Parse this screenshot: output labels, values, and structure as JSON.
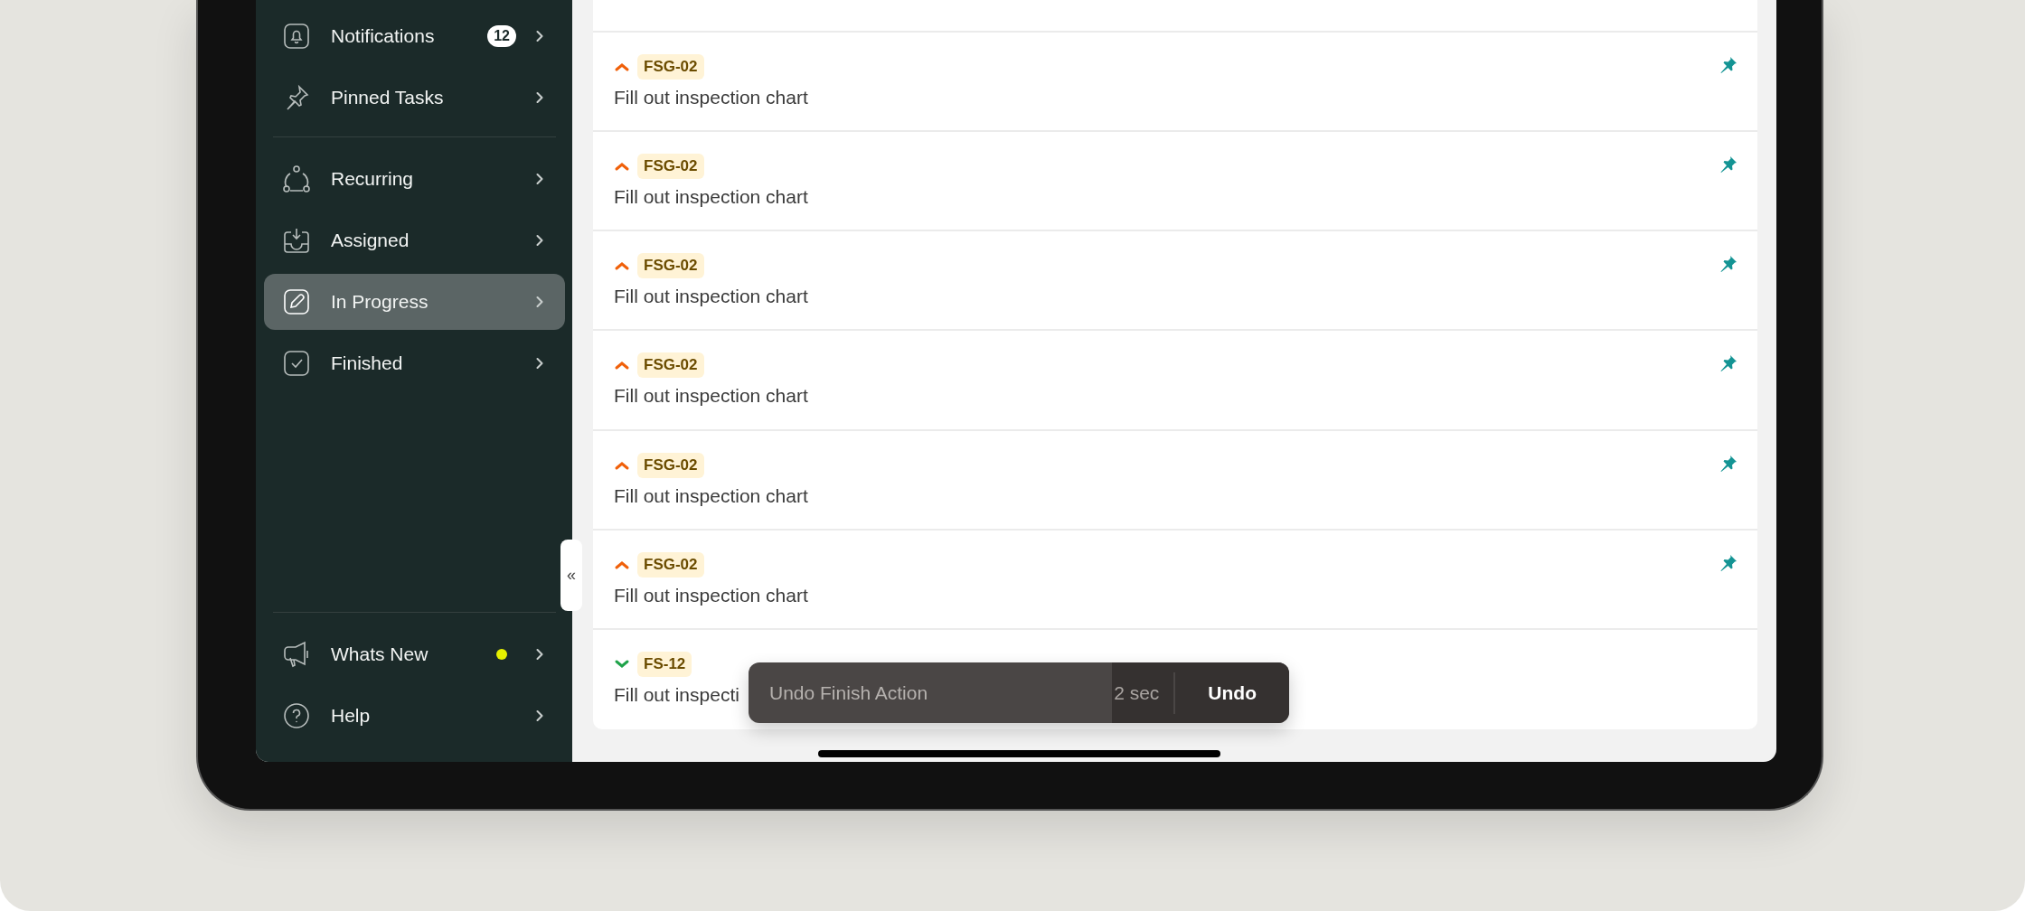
{
  "sidebar": {
    "groups": [
      [
        {
          "kind": "bell",
          "label": "Notifications",
          "badge": "12",
          "selected": false
        },
        {
          "kind": "pin",
          "label": "Pinned Tasks",
          "selected": false
        }
      ],
      [
        {
          "kind": "recurring",
          "label": "Recurring",
          "selected": false
        },
        {
          "kind": "inbox",
          "label": "Assigned",
          "selected": false
        },
        {
          "kind": "pencil",
          "label": "In Progress",
          "selected": true
        },
        {
          "kind": "check",
          "label": "Finished",
          "selected": false
        }
      ]
    ],
    "footer_items": [
      {
        "kind": "megaphone",
        "label": "Whats New",
        "new_indicator": true
      },
      {
        "kind": "help",
        "label": "Help",
        "new_indicator": false
      }
    ],
    "collapse_button": "«"
  },
  "tasks": [
    {
      "kind": "high",
      "tag": "FSG-02",
      "title": "Fill out inspection chart",
      "pinned": true
    },
    {
      "kind": "high",
      "tag": "FSG-02",
      "title": "Fill out inspection chart",
      "pinned": true
    },
    {
      "kind": "high",
      "tag": "FSG-02",
      "title": "Fill out inspection chart",
      "pinned": true
    },
    {
      "kind": "high",
      "tag": "FSG-02",
      "title": "Fill out inspection chart",
      "pinned": true
    },
    {
      "kind": "high",
      "tag": "FSG-02",
      "title": "Fill out inspection chart",
      "pinned": true
    },
    {
      "kind": "high",
      "tag": "FSG-02",
      "title": "Fill out inspection chart",
      "pinned": true
    },
    {
      "kind": "low",
      "tag": "FS-12",
      "title": "Fill out inspecti",
      "pinned": false
    }
  ],
  "toast": {
    "message": "Undo Finish Action",
    "countdown": "2 sec",
    "action": "Undo"
  }
}
